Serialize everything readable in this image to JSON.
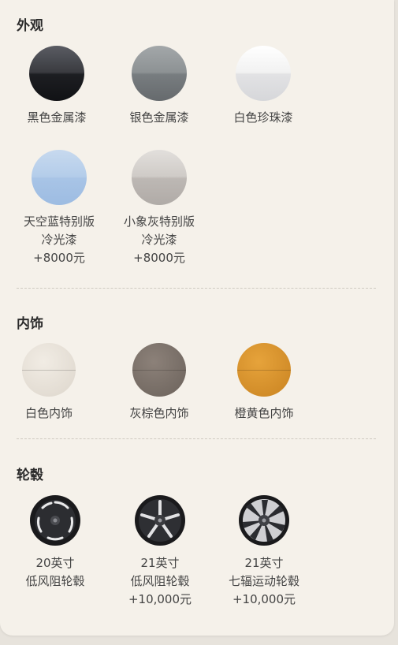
{
  "sections": {
    "exterior": {
      "title": "外观",
      "options": [
        {
          "lines": [
            "黑色金属漆"
          ],
          "color": "#2b2c30"
        },
        {
          "lines": [
            "银色金属漆"
          ],
          "color": "#858a8c"
        },
        {
          "lines": [
            "白色珍珠漆"
          ],
          "color": "#f0f0f0"
        },
        {
          "lines": [
            "天空蓝特别版",
            "冷光漆",
            "+8000元"
          ],
          "color": "#b2cbe9"
        },
        {
          "lines": [
            "小象灰特别版",
            "冷光漆",
            "+8000元"
          ],
          "color": "#c9c5c1"
        }
      ]
    },
    "interior": {
      "title": "内饰",
      "options": [
        {
          "lines": [
            "白色内饰"
          ],
          "color": "#e6e0d6"
        },
        {
          "lines": [
            "灰棕色内饰"
          ],
          "color": "#7b716a"
        },
        {
          "lines": [
            "橙黄色内饰"
          ],
          "color": "#d9932d"
        }
      ]
    },
    "wheels": {
      "title": "轮毂",
      "options": [
        {
          "lines": [
            "20英寸",
            "低风阻轮毂"
          ]
        },
        {
          "lines": [
            "21英寸",
            "低风阻轮毂",
            "+10,000元"
          ]
        },
        {
          "lines": [
            "21英寸",
            "七辐运动轮毂",
            "+10,000元"
          ]
        }
      ]
    }
  }
}
